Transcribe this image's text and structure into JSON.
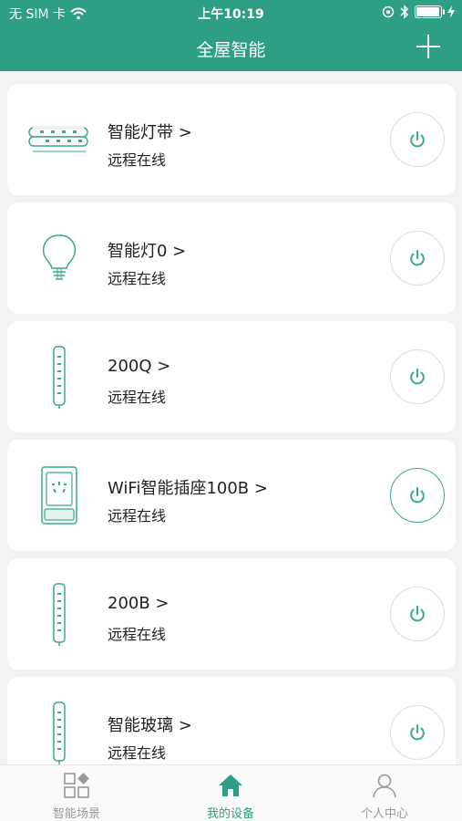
{
  "status_bar": {
    "carrier": "无 SIM 卡",
    "time": "上午10:19"
  },
  "header": {
    "title": "全屋智能",
    "add_icon": "plus-icon"
  },
  "devices": [
    {
      "name": "智能灯带 >",
      "status": "远程在线",
      "icon": "led-strip-icon",
      "power_on": false
    },
    {
      "name": "智能灯0 >",
      "status": "远程在线",
      "icon": "bulb-icon",
      "power_on": false
    },
    {
      "name": "200Q >",
      "status": "远程在线",
      "icon": "power-strip-icon",
      "power_on": false
    },
    {
      "name": "WiFi智能插座100B >",
      "status": "远程在线",
      "icon": "smart-plug-icon",
      "power_on": true
    },
    {
      "name": "200B >",
      "status": "远程在线",
      "icon": "power-strip-icon",
      "power_on": false
    },
    {
      "name": "智能玻璃 >",
      "status": "远程在线",
      "icon": "power-strip-icon",
      "power_on": false
    }
  ],
  "tabs": [
    {
      "label": "智能场景",
      "icon": "scenes-icon",
      "active": false
    },
    {
      "label": "我的设备",
      "icon": "home-icon",
      "active": true
    },
    {
      "label": "个人中心",
      "icon": "user-icon",
      "active": false
    }
  ],
  "colors": {
    "brand": "#2e9f84",
    "power_icon": "#3aa88c"
  }
}
